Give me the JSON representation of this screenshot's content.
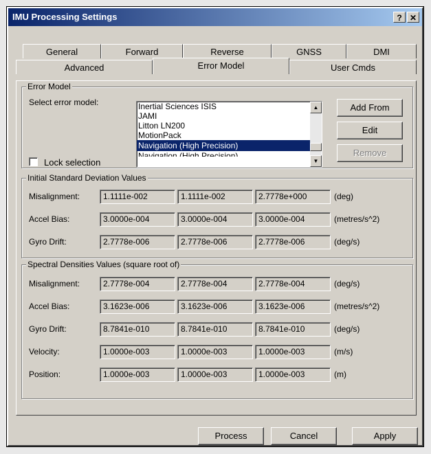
{
  "window": {
    "title": "IMU Processing Settings",
    "help_label": "?",
    "close_label": "✕"
  },
  "tabs_row1": [
    "General",
    "Forward",
    "Reverse",
    "GNSS",
    "DMI"
  ],
  "tabs_row2": [
    "Advanced",
    "Error Model",
    "User Cmds"
  ],
  "active_tab": "Error Model",
  "error_model": {
    "group_label": "Error Model",
    "select_label": "Select error model:",
    "list_items": [
      "Inertial Sciences ISIS",
      "JAMI",
      "Litton LN200",
      "MotionPack",
      "Navigation (High Precision)",
      "Navigation (High Precision) ..."
    ],
    "selected_index": 4,
    "lock_label": "Lock selection",
    "lock_checked": false,
    "add_from_label": "Add From",
    "edit_label": "Edit",
    "remove_label": "Remove"
  },
  "initial_sd": {
    "group_label": "Initial Standard Deviation Values",
    "rows": [
      {
        "label": "Misalignment:",
        "values": [
          "1.1111e-002",
          "1.1111e-002",
          "2.7778e+000"
        ],
        "unit": "(deg)"
      },
      {
        "label": "Accel Bias:",
        "values": [
          "3.0000e-004",
          "3.0000e-004",
          "3.0000e-004"
        ],
        "unit": "(metres/s^2)"
      },
      {
        "label": "Gyro Drift:",
        "values": [
          "2.7778e-006",
          "2.7778e-006",
          "2.7778e-006"
        ],
        "unit": "(deg/s)"
      }
    ]
  },
  "spectral": {
    "group_label": "Spectral Densities Values (square root of)",
    "rows": [
      {
        "label": "Misalignment:",
        "values": [
          "2.7778e-004",
          "2.7778e-004",
          "2.7778e-004"
        ],
        "unit": "(deg/s)"
      },
      {
        "label": "Accel Bias:",
        "values": [
          "3.1623e-006",
          "3.1623e-006",
          "3.1623e-006"
        ],
        "unit": "(metres/s^2)"
      },
      {
        "label": "Gyro Drift:",
        "values": [
          "8.7841e-010",
          "8.7841e-010",
          "8.7841e-010"
        ],
        "unit": "(deg/s)"
      },
      {
        "label": "Velocity:",
        "values": [
          "1.0000e-003",
          "1.0000e-003",
          "1.0000e-003"
        ],
        "unit": "(m/s)"
      },
      {
        "label": "Position:",
        "values": [
          "1.0000e-003",
          "1.0000e-003",
          "1.0000e-003"
        ],
        "unit": "(m)"
      }
    ]
  },
  "footer": {
    "process_label": "Process",
    "cancel_label": "Cancel",
    "apply_label": "Apply"
  }
}
